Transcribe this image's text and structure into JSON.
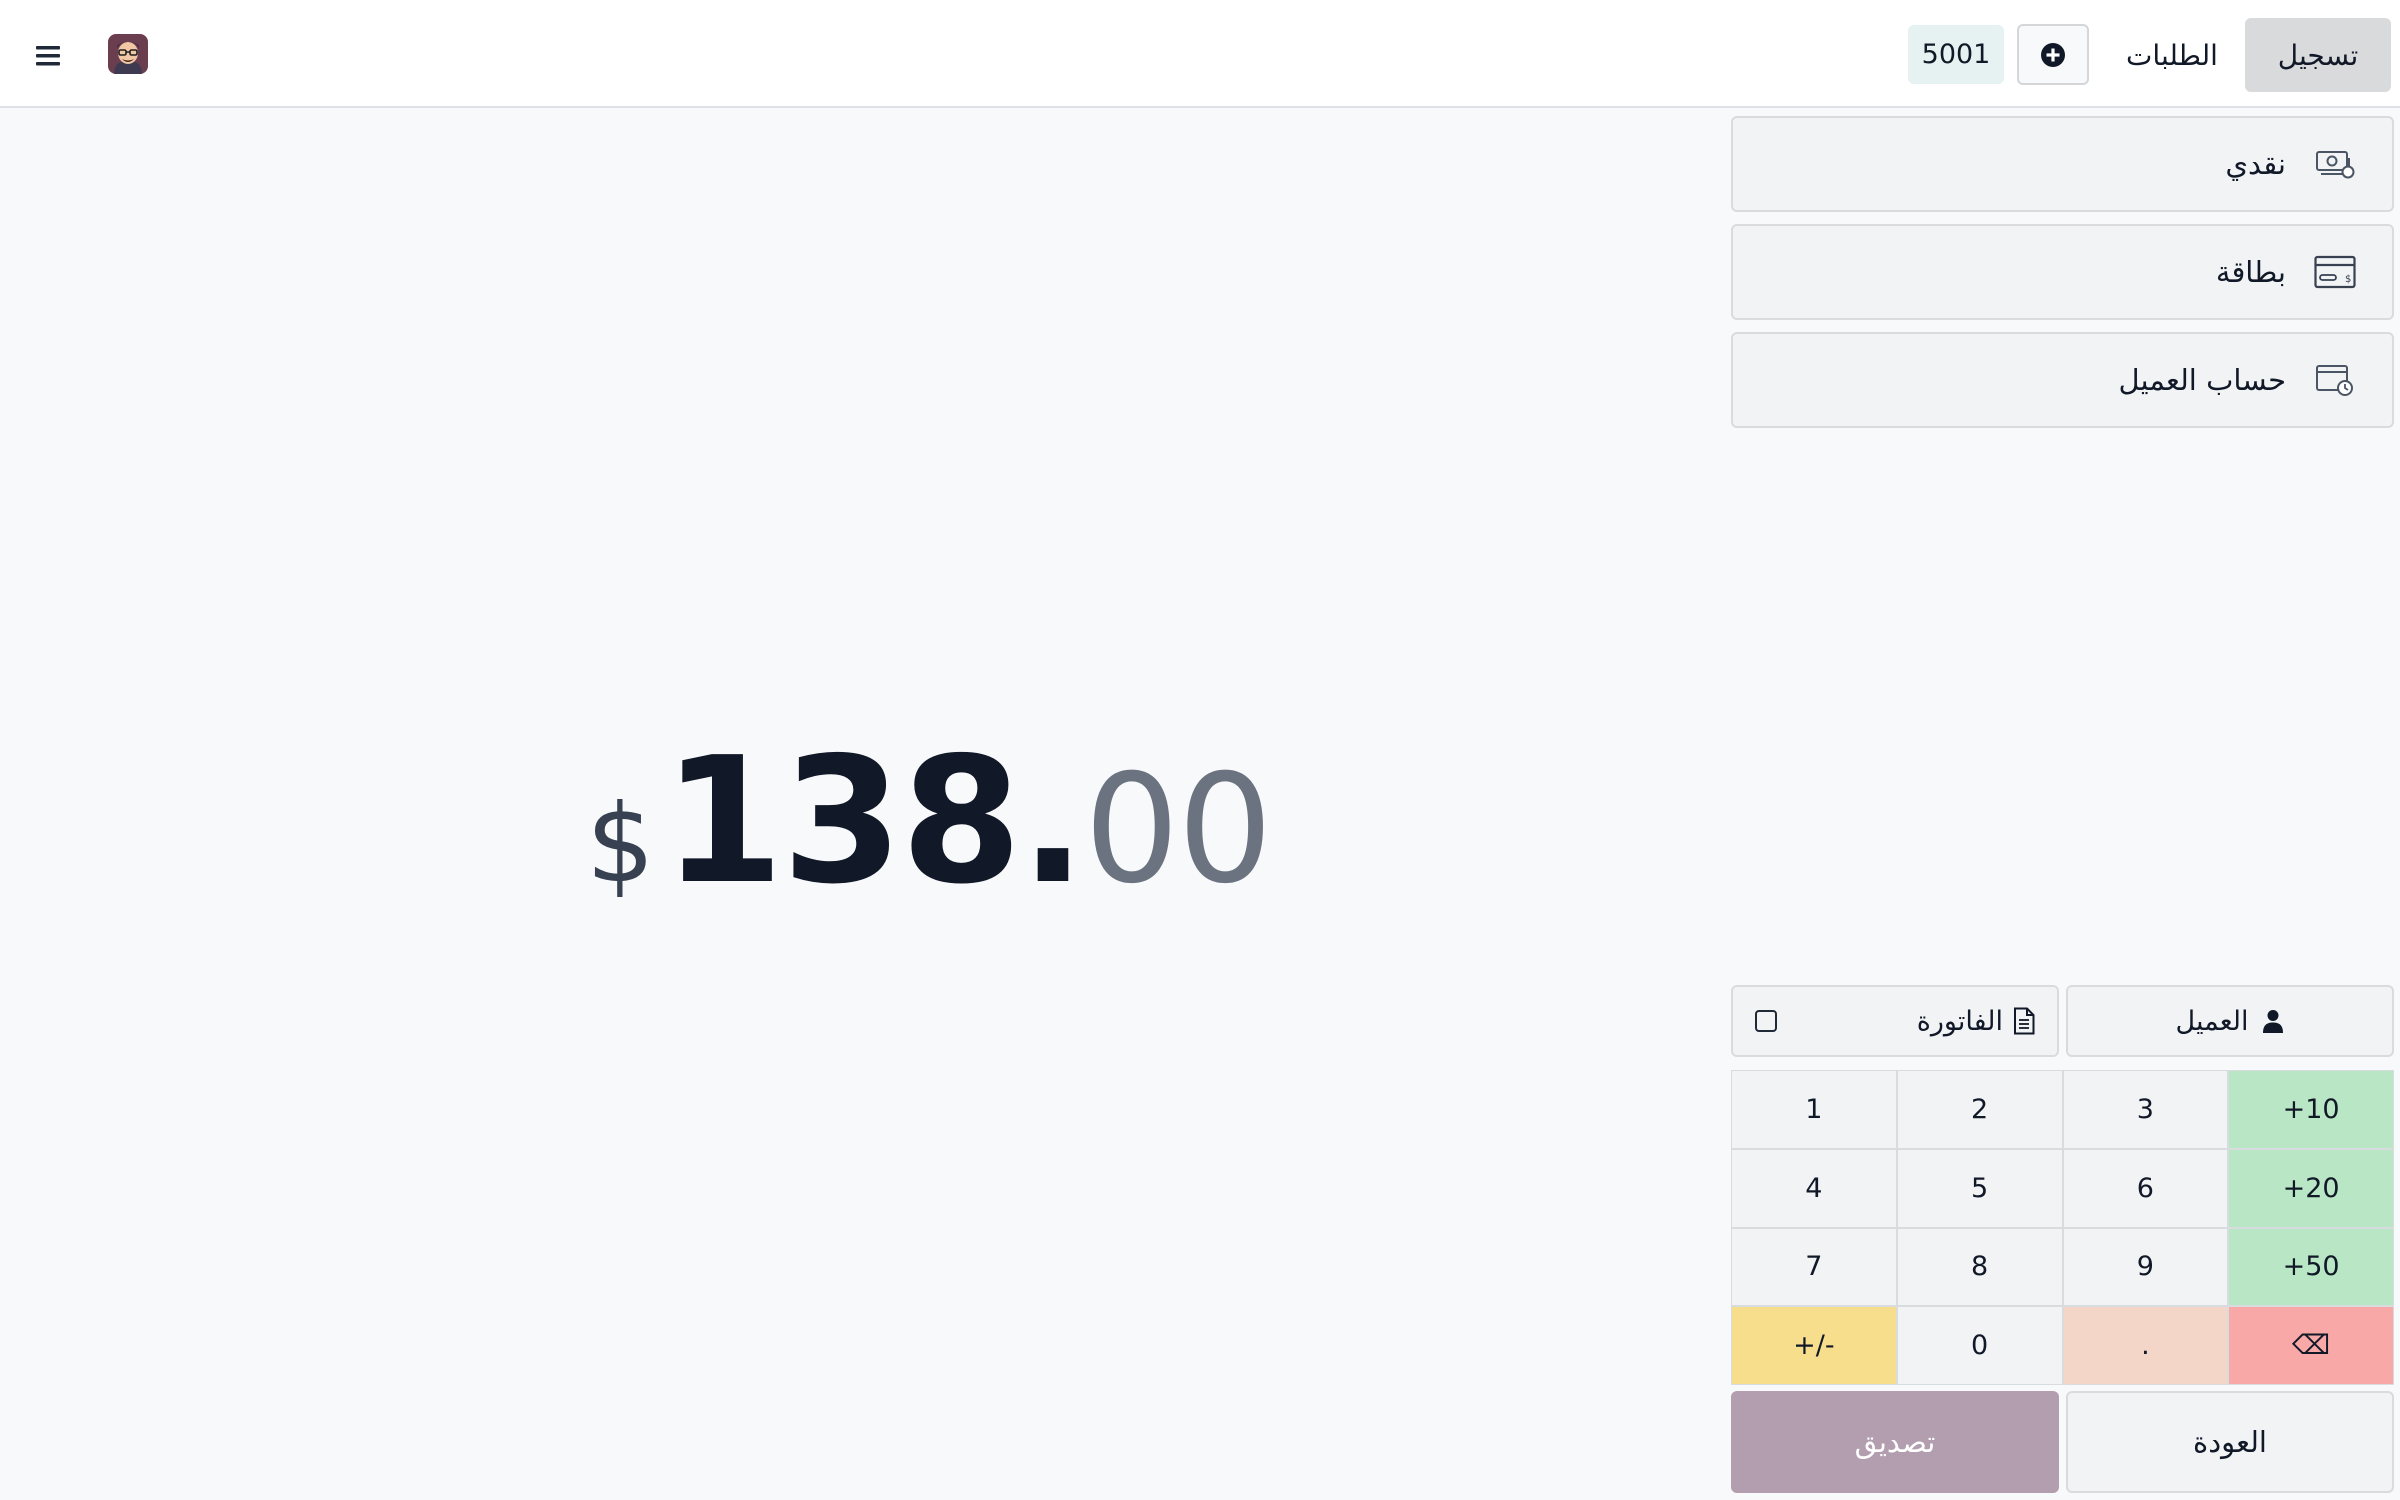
{
  "navbar": {
    "register_label": "تسجيل",
    "orders_label": "الطلبات",
    "order_number": "5001"
  },
  "payment_methods": [
    {
      "label": "نقدي",
      "icon": "cash-icon"
    },
    {
      "label": "بطاقة",
      "icon": "credit-card-icon"
    },
    {
      "label": "حساب العميل",
      "icon": "wallet-clock-icon"
    }
  ],
  "total": {
    "currency": "$",
    "integer": "138.",
    "decimals": "00"
  },
  "actions": {
    "customer_label": "العميل",
    "invoice_label": "الفاتورة"
  },
  "numpad": {
    "keys": [
      "+10",
      "3",
      "2",
      "1",
      "+20",
      "6",
      "5",
      "4",
      "+50",
      "9",
      "8",
      "7",
      "⌫",
      ".",
      "0",
      "+/-"
    ]
  },
  "footer": {
    "back_label": "العودة",
    "validate_label": "تصديق"
  },
  "colors": {
    "numpad_quick_add": "#b9e6c4",
    "numpad_backspace": "#f7a8a7",
    "numpad_decimal": "#f3d6c8",
    "numpad_sign": "#f6de8c",
    "validate_button": "#b29eaf",
    "register_active": "#d9dadc"
  }
}
